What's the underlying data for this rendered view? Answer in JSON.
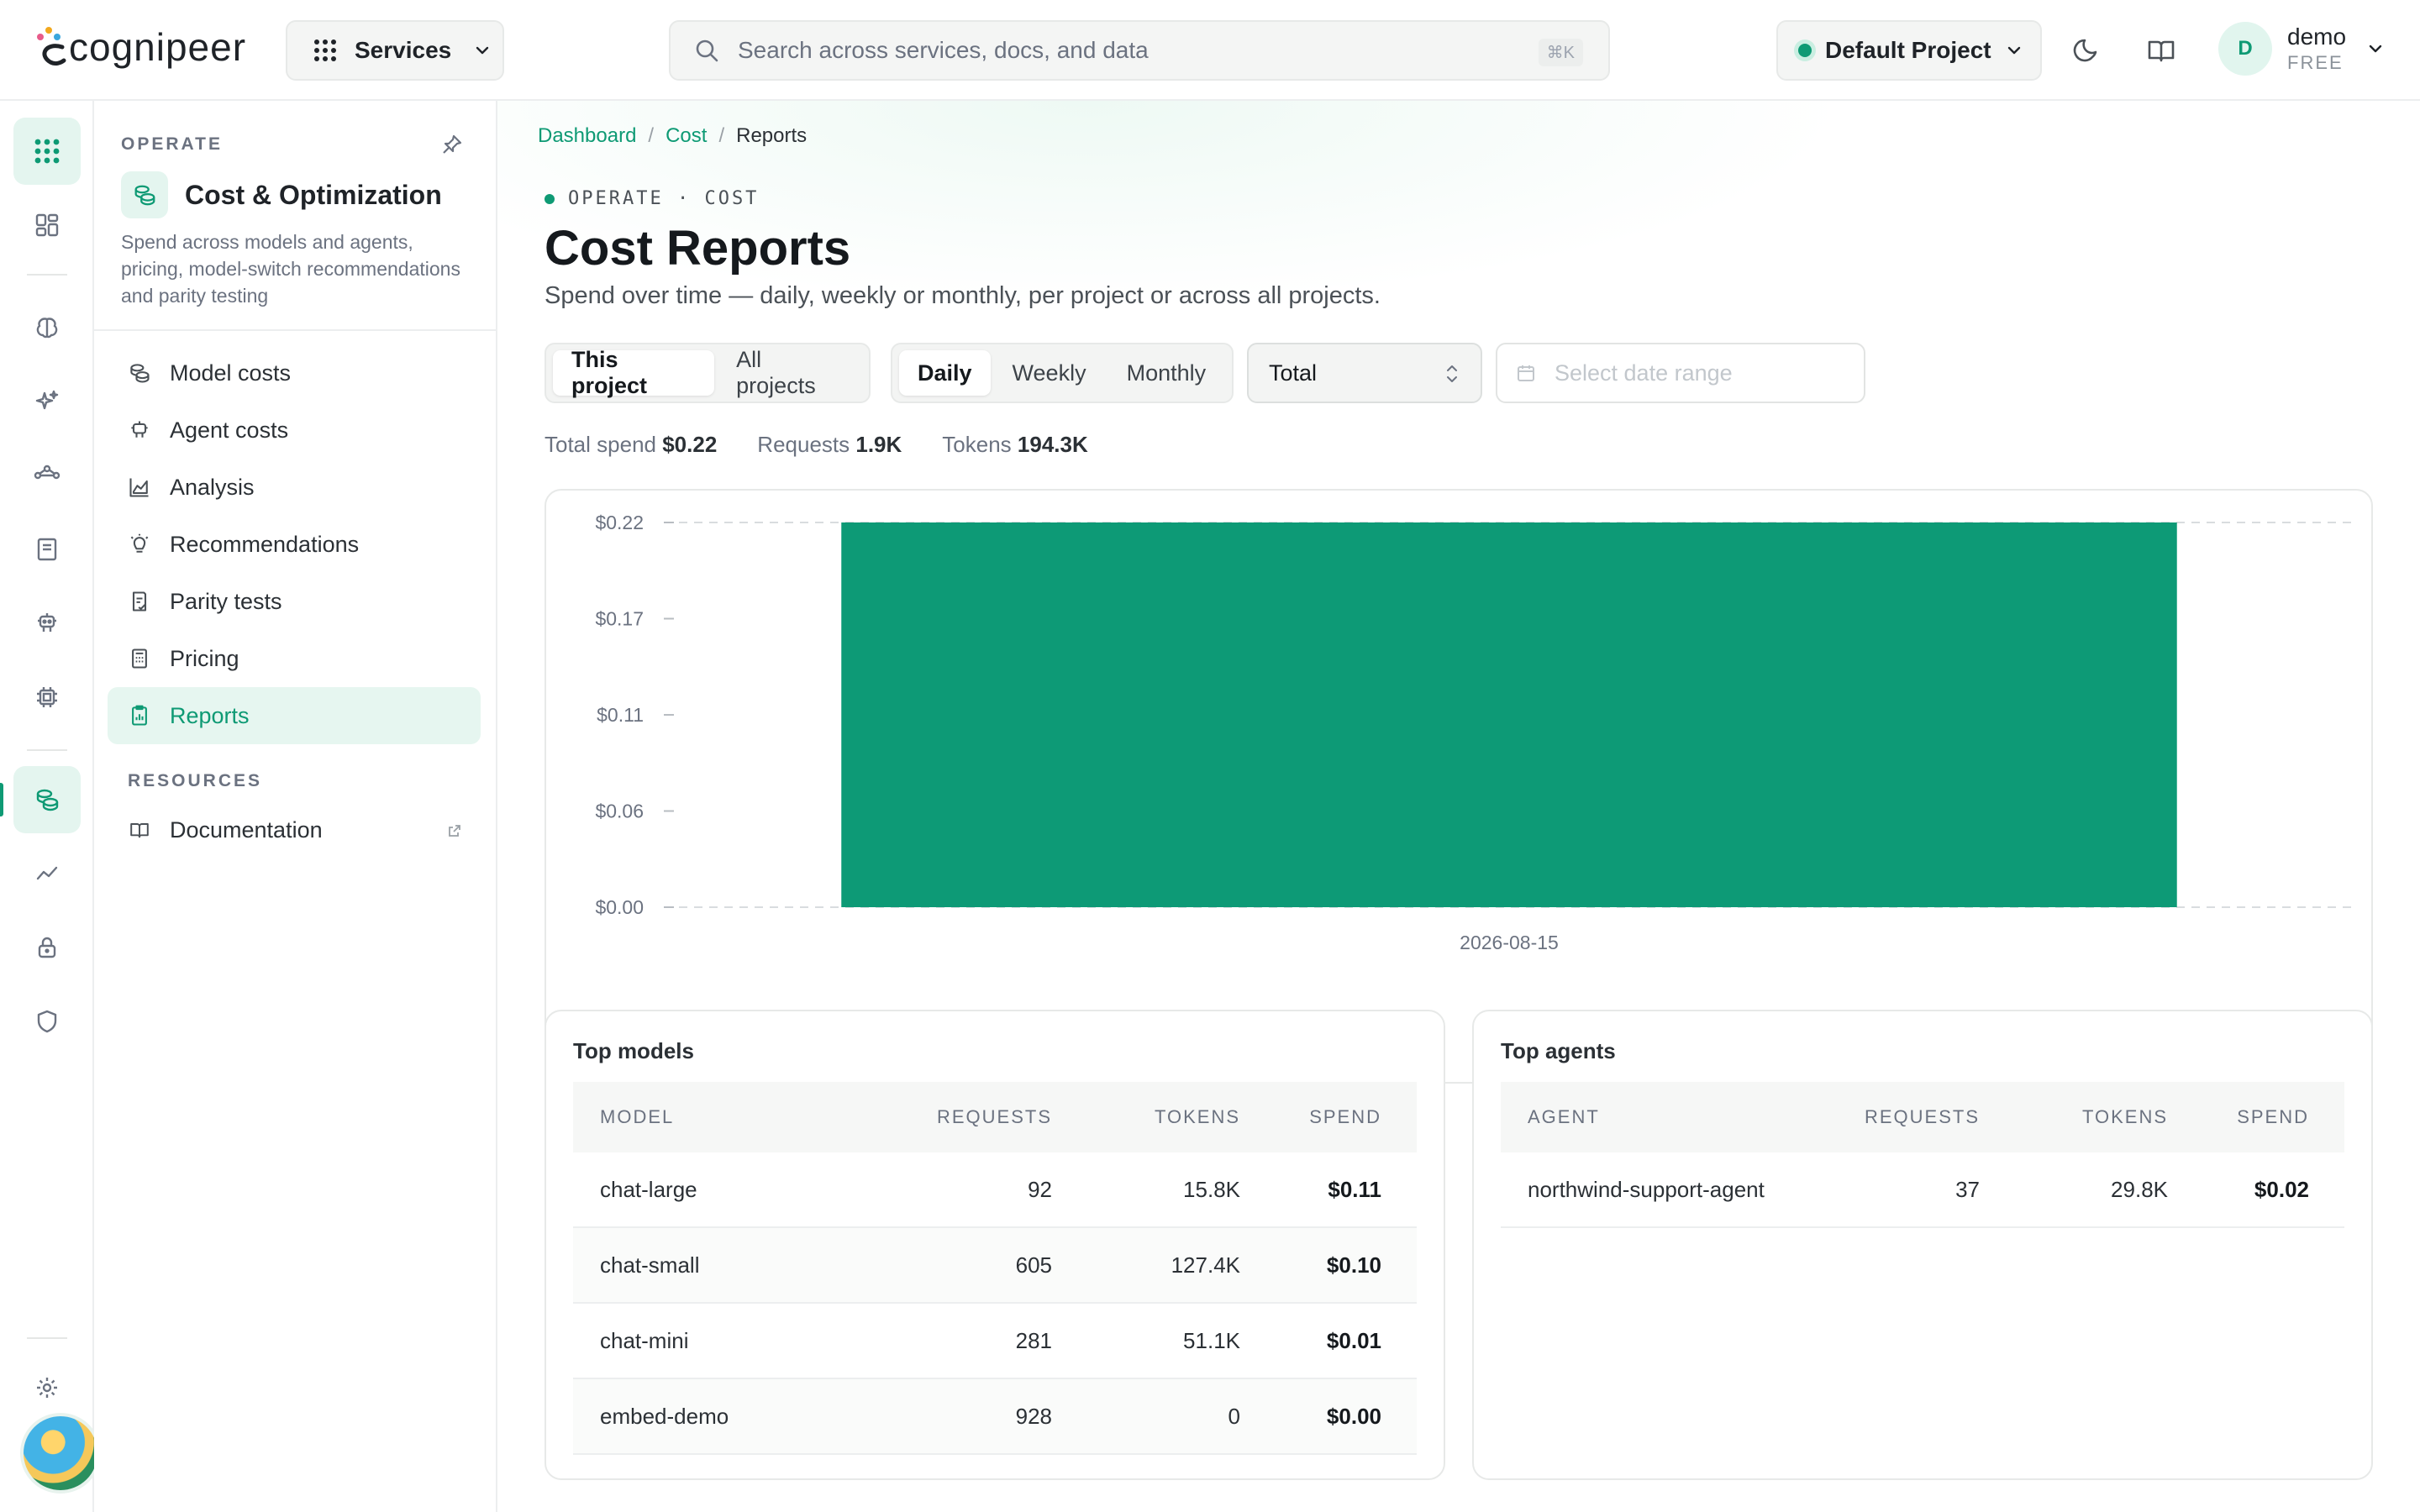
{
  "header": {
    "logo_text": "cognipeer",
    "services_label": "Services",
    "search_placeholder": "Search across services, docs, and data",
    "search_shortcut": "⌘K",
    "project_label": "Default Project",
    "user_initial": "D",
    "user_name": "demo",
    "user_plan": "FREE"
  },
  "rail": {
    "icons": [
      "apps-grid-icon",
      "dashboard-icon",
      "brain-icon",
      "sparkles-icon",
      "workflow-icon",
      "book-icon",
      "robot-icon",
      "chip-icon",
      "coins-icon",
      "trend-line-icon",
      "lock-icon",
      "shield-icon",
      "settings-icon"
    ],
    "active": "coins-icon"
  },
  "sidebar": {
    "eyebrow": "OPERATE",
    "title": "Cost & Optimization",
    "description": "Spend across models and agents, pricing, model-switch recommendations and parity testing",
    "items": [
      {
        "label": "Model costs",
        "icon": "coins-icon"
      },
      {
        "label": "Agent costs",
        "icon": "robot-icon"
      },
      {
        "label": "Analysis",
        "icon": "area-chart-icon"
      },
      {
        "label": "Recommendations",
        "icon": "lightbulb-icon"
      },
      {
        "label": "Parity tests",
        "icon": "clipboard-check-icon"
      },
      {
        "label": "Pricing",
        "icon": "calculator-icon"
      },
      {
        "label": "Reports",
        "icon": "report-icon"
      }
    ],
    "active_item": "Reports",
    "resources_label": "RESOURCES",
    "resources": [
      {
        "label": "Documentation",
        "icon": "book-open-icon"
      }
    ]
  },
  "main": {
    "breadcrumb": [
      "Dashboard",
      "Cost",
      "Reports"
    ],
    "eyebrow": "OPERATE · COST",
    "title": "Cost Reports",
    "subtitle": "Spend over time — daily, weekly or monthly, per project or across all projects.",
    "scope_options": [
      "This project",
      "All projects"
    ],
    "scope_selected": "This project",
    "period_options": [
      "Daily",
      "Weekly",
      "Monthly"
    ],
    "period_selected": "Daily",
    "group_select": "Total",
    "date_placeholder": "Select date range",
    "stats": [
      {
        "label": "Total spend",
        "value": "$0.22"
      },
      {
        "label": "Requests",
        "value": "1.9K"
      },
      {
        "label": "Tokens",
        "value": "194.3K"
      }
    ]
  },
  "chart_data": {
    "type": "bar",
    "categories": [
      "2026-08-15"
    ],
    "values": [
      0.22
    ],
    "ylim": [
      0,
      0.22
    ],
    "yticks": [
      "$0.00",
      "$0.06",
      "$0.11",
      "$0.17",
      "$0.22"
    ],
    "ytick_values": [
      0,
      0.055,
      0.11,
      0.165,
      0.22
    ],
    "grid": "dashed horizontal",
    "bar_color": "#0d9a76",
    "title": "",
    "xlabel": "",
    "ylabel": ""
  },
  "top_models": {
    "title": "Top models",
    "columns": [
      "MODEL",
      "REQUESTS",
      "TOKENS",
      "SPEND"
    ],
    "rows": [
      [
        "chat-large",
        "92",
        "15.8K",
        "$0.11"
      ],
      [
        "chat-small",
        "605",
        "127.4K",
        "$0.10"
      ],
      [
        "chat-mini",
        "281",
        "51.1K",
        "$0.01"
      ],
      [
        "embed-demo",
        "928",
        "0",
        "$0.00"
      ]
    ]
  },
  "top_agents": {
    "title": "Top agents",
    "columns": [
      "AGENT",
      "REQUESTS",
      "TOKENS",
      "SPEND"
    ],
    "rows": [
      [
        "northwind-support-agent",
        "37",
        "29.8K",
        "$0.02"
      ]
    ]
  },
  "colors": {
    "accent": "#0e9a74",
    "accent_soft": "#e4f5ef",
    "text": "#1f2328",
    "muted": "#6b7280"
  }
}
